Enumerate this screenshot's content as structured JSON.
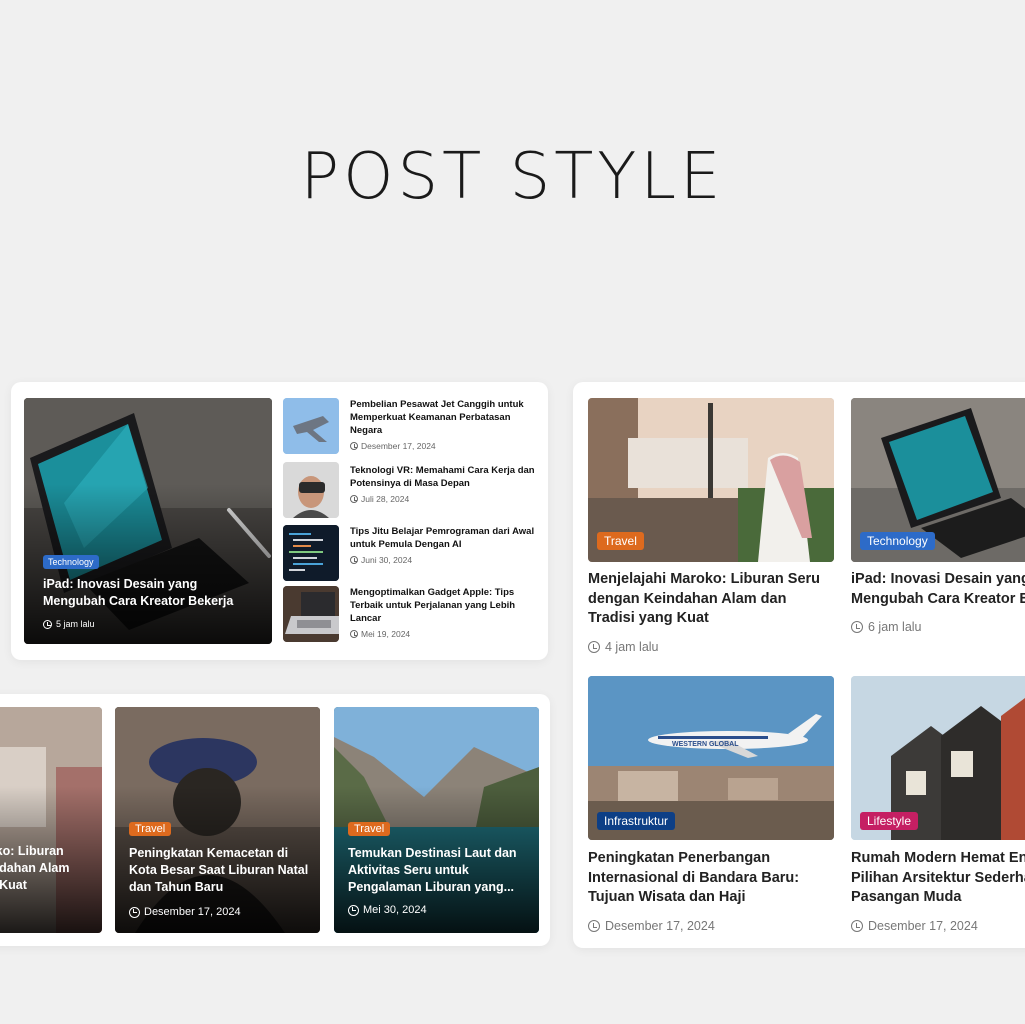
{
  "page_title": "POST STYLE",
  "colors": {
    "technology": "#2d6bc8",
    "travel": "#dd6a1e",
    "infrastruktur": "#0d3f86",
    "lifestyle": "#c51f63"
  },
  "featured_list_card": {
    "main": {
      "category": "Technology",
      "title": "iPad: Inovasi Desain yang Mengubah Cara Kreator Bekerja",
      "time": "5 jam lalu",
      "image": "ipad-keyboard-image"
    },
    "items": [
      {
        "title": "Pembelian Pesawat Jet Canggih untuk Memperkuat Keamanan Perbatasan Negara",
        "date": "Desember 17, 2024",
        "image": "fighter-jet-image"
      },
      {
        "title": "Teknologi VR: Memahami Cara Kerja dan Potensinya di Masa Depan",
        "date": "Juli 28, 2024",
        "image": "vr-headset-image"
      },
      {
        "title": "Tips Jitu Belajar Pemrograman dari Awal untuk Pemula Dengan AI",
        "date": "Juni 30, 2024",
        "image": "code-screen-image"
      },
      {
        "title": "Mengoptimalkan Gadget Apple: Tips Terbaik untuk Perjalanan yang Lebih Lancar",
        "date": "Mei 19, 2024",
        "image": "macbook-image"
      }
    ]
  },
  "carousel_card": {
    "items": [
      {
        "category": "",
        "title_lines": [
          "oko: Liburan",
          "indahan Alam",
          "g Kuat"
        ],
        "date": ""
      },
      {
        "category": "Travel",
        "title": "Peningkatan Kemacetan di Kota Besar Saat Liburan Natal dan Tahun Baru",
        "date": "Desember 17, 2024"
      },
      {
        "category": "Travel",
        "title": "Temukan Destinasi Laut dan Aktivitas Seru untuk Pengalaman Liburan yang...",
        "date": "Mei 30, 2024"
      }
    ]
  },
  "grid_card": {
    "items": [
      {
        "category": "Travel",
        "title": "Menjelajahi Maroko: Liburan Seru dengan Keindahan Alam dan Tradisi yang Kuat",
        "time": "4 jam lalu"
      },
      {
        "category": "Technology",
        "title_lines": [
          "iPad: Inovasi Desain yang",
          "Mengubah Cara Kreator B"
        ],
        "time": "6 jam lalu"
      },
      {
        "category": "Infrastruktur",
        "title": "Peningkatan Penerbangan Internasional di Bandara Baru: Tujuan Wisata dan Haji",
        "date": "Desember 17, 2024",
        "plane_text": "WESTERN GLOBAL"
      },
      {
        "category": "Lifestyle",
        "title_lines": [
          "Rumah Modern Hemat Ene",
          "Pilihan Arsitektur Sederha",
          "Pasangan Muda"
        ],
        "date": "Desember 17, 2024"
      }
    ]
  }
}
